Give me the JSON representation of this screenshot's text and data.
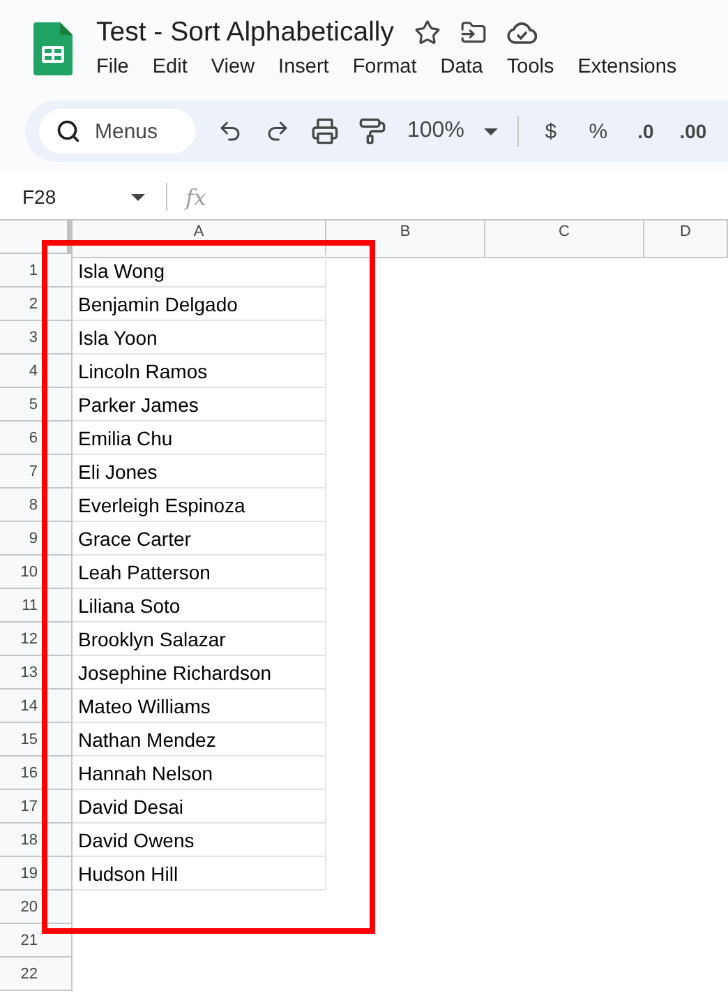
{
  "document": {
    "title": "Test - Sort Alphabetically"
  },
  "menu": [
    "File",
    "Edit",
    "View",
    "Insert",
    "Format",
    "Data",
    "Tools",
    "Extensions"
  ],
  "toolbar": {
    "search_placeholder": "Menus",
    "zoom": "100%",
    "currency": "$",
    "percent": "%",
    "decrease_decimals": ".0",
    "increase_decimals": ".00"
  },
  "formula_bar": {
    "cell_reference": "F28",
    "fx": "fx"
  },
  "columns": [
    "A",
    "B",
    "C",
    "D"
  ],
  "rows": [
    {
      "number": "1",
      "value": "Isla Wong"
    },
    {
      "number": "2",
      "value": "Benjamin Delgado"
    },
    {
      "number": "3",
      "value": "Isla Yoon"
    },
    {
      "number": "4",
      "value": "Lincoln Ramos"
    },
    {
      "number": "5",
      "value": "Parker James"
    },
    {
      "number": "6",
      "value": "Emilia Chu"
    },
    {
      "number": "7",
      "value": "Eli Jones"
    },
    {
      "number": "8",
      "value": "Everleigh Espinoza"
    },
    {
      "number": "9",
      "value": "Grace Carter"
    },
    {
      "number": "10",
      "value": "Leah Patterson"
    },
    {
      "number": "11",
      "value": "Liliana Soto"
    },
    {
      "number": "12",
      "value": "Brooklyn Salazar"
    },
    {
      "number": "13",
      "value": "Josephine Richardson"
    },
    {
      "number": "14",
      "value": "Mateo Williams"
    },
    {
      "number": "15",
      "value": "Nathan Mendez"
    },
    {
      "number": "16",
      "value": "Hannah Nelson"
    },
    {
      "number": "17",
      "value": "David Desai"
    },
    {
      "number": "18",
      "value": "David Owens"
    },
    {
      "number": "19",
      "value": "Hudson Hill"
    },
    {
      "number": "20"
    },
    {
      "number": "21"
    },
    {
      "number": "22"
    }
  ]
}
